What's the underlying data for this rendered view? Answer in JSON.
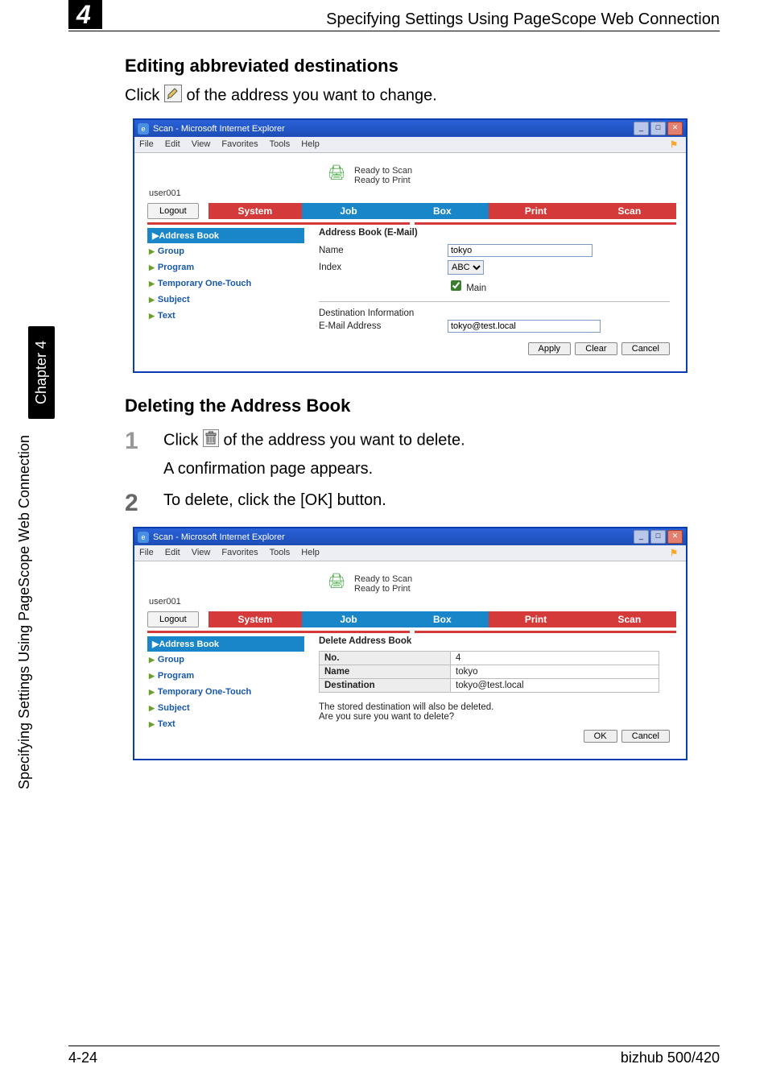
{
  "header": {
    "big_number": "4",
    "title": "Specifying Settings Using PageScope Web Connection"
  },
  "sidebar": {
    "rotated_text": "Specifying Settings Using PageScope Web Connection",
    "chapter_tab": "Chapter 4"
  },
  "section1": {
    "heading": "Editing abbreviated destinations",
    "line": "Click  of the address you want to change."
  },
  "section2": {
    "heading": "Deleting the Address Book",
    "step1_line1": "Click  of the address you want to delete.",
    "step1_line2": "A confirmation page appears.",
    "step2_line1": "To delete, click the [OK] button."
  },
  "ie_common": {
    "title": "Scan - Microsoft Internet Explorer",
    "menu": [
      "File",
      "Edit",
      "View",
      "Favorites",
      "Tools",
      "Help"
    ],
    "ready_scan": "Ready to Scan",
    "ready_print": "Ready to Print",
    "user": "user001",
    "logout": "Logout",
    "tabs": {
      "system": "System",
      "job": "Job",
      "box": "Box",
      "print": "Print",
      "scan": "Scan"
    },
    "leftnav": {
      "head": "Address Book",
      "items": [
        "Group",
        "Program",
        "Temporary One-Touch",
        "Subject",
        "Text"
      ]
    }
  },
  "shot1": {
    "pane_title": "Address Book (E-Mail)",
    "name_label": "Name",
    "name_value": "tokyo",
    "index_label": "Index",
    "index_value": "ABC",
    "main_label": "Main",
    "dest_info_label": "Destination Information",
    "email_label": "E-Mail Address",
    "email_value": "tokyo@test.local",
    "buttons": {
      "apply": "Apply",
      "clear": "Clear",
      "cancel": "Cancel"
    }
  },
  "shot2": {
    "pane_title": "Delete Address Book",
    "rows": {
      "no_label": "No.",
      "no_value": "4",
      "name_label": "Name",
      "name_value": "tokyo",
      "dest_label": "Destination",
      "dest_value": "tokyo@test.local"
    },
    "warn1": "The stored destination will also be deleted.",
    "warn2": "Are you sure you want to delete?",
    "buttons": {
      "ok": "OK",
      "cancel": "Cancel"
    }
  },
  "footer": {
    "left": "4-24",
    "right": "bizhub 500/420"
  }
}
